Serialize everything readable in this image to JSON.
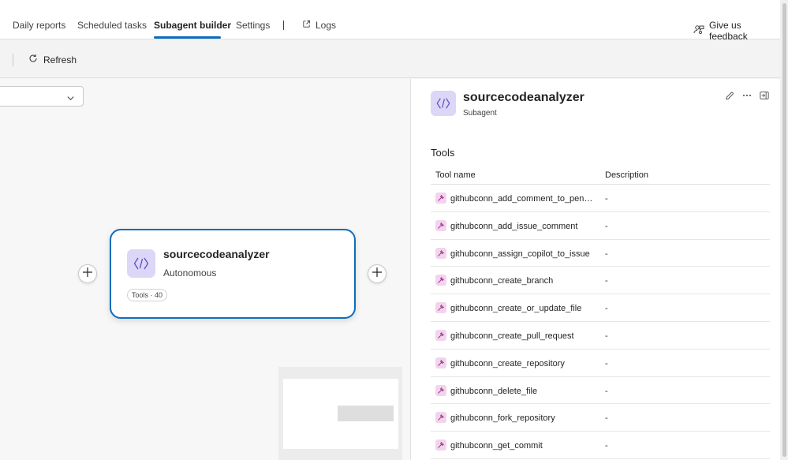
{
  "nav": {
    "tabs": [
      {
        "label": "Daily reports"
      },
      {
        "label": "Scheduled tasks"
      },
      {
        "label": "Subagent builder"
      },
      {
        "label": "Settings"
      }
    ],
    "active_tab": "Subagent builder",
    "logs_label": "Logs",
    "feedback_label": "Give us feedback"
  },
  "toolbar": {
    "refresh_label": "Refresh"
  },
  "canvas": {
    "node": {
      "title": "sourcecodeanalyzer",
      "subtitle": "Autonomous",
      "badge": "Tools · 40"
    }
  },
  "panel": {
    "title": "sourcecodeanalyzer",
    "subtitle": "Subagent",
    "section_title": "Tools",
    "columns": {
      "name": "Tool name",
      "description": "Description"
    },
    "tools": [
      {
        "name": "githubconn_add_comment_to_pending_review",
        "description": "-"
      },
      {
        "name": "githubconn_add_issue_comment",
        "description": "-"
      },
      {
        "name": "githubconn_assign_copilot_to_issue",
        "description": "-"
      },
      {
        "name": "githubconn_create_branch",
        "description": "-"
      },
      {
        "name": "githubconn_create_or_update_file",
        "description": "-"
      },
      {
        "name": "githubconn_create_pull_request",
        "description": "-"
      },
      {
        "name": "githubconn_create_repository",
        "description": "-"
      },
      {
        "name": "githubconn_delete_file",
        "description": "-"
      },
      {
        "name": "githubconn_fork_repository",
        "description": "-"
      },
      {
        "name": "githubconn_get_commit",
        "description": "-"
      }
    ]
  },
  "colors": {
    "accent": "#0f6cbd",
    "agent_icon_bg": "#dcd6f7",
    "tool_icon_bg": "#f2d4ec"
  },
  "icons": {
    "refresh": "refresh-icon",
    "logs": "external-link-icon",
    "feedback": "people-feedback-icon",
    "agent": "code-icon",
    "tool": "wrench-icon",
    "edit": "pencil-icon",
    "more": "more-icon",
    "collapse": "collapse-panel-icon"
  }
}
